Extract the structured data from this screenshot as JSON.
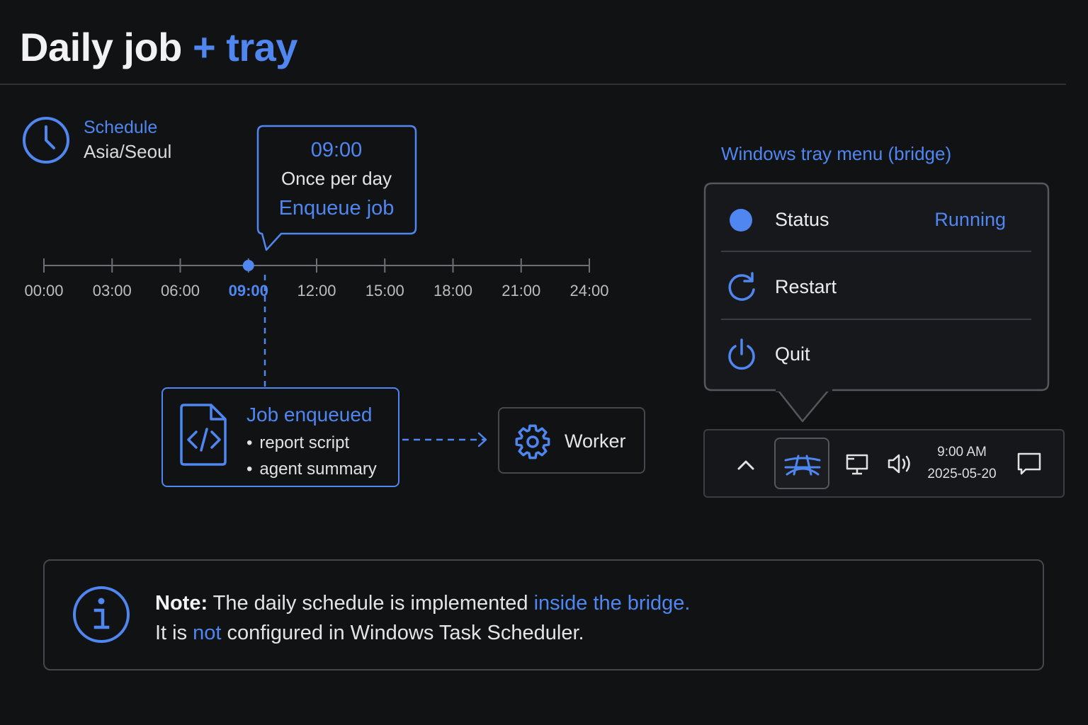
{
  "header": {
    "title_main": "Daily job",
    "title_accent": "+ tray"
  },
  "schedule": {
    "label": "Schedule",
    "timezone": "Asia/Seoul",
    "icon": "clock-icon"
  },
  "callout": {
    "time": "09:00",
    "frequency": "Once per day",
    "action": "Enqueue job"
  },
  "timeline": {
    "ticks": [
      "00:00",
      "03:00",
      "06:00",
      "09:00",
      "12:00",
      "15:00",
      "18:00",
      "21:00",
      "24:00"
    ],
    "active": "09:00"
  },
  "job": {
    "title": "Job enqueued",
    "items": [
      "report script",
      "agent summary"
    ],
    "icon": "code-file-icon"
  },
  "worker": {
    "label": "Worker",
    "icon": "gear-icon"
  },
  "tray_menu": {
    "title": "Windows tray menu (bridge)",
    "status_label": "Status",
    "status_value": "Running",
    "restart_label": "Restart",
    "quit_label": "Quit"
  },
  "taskbar": {
    "time": "9:00 AM",
    "date": "2025-05-20"
  },
  "note": {
    "lead": "Note:",
    "line1_text": " The daily schedule is implemented ",
    "line1_highlight": "inside the bridge.",
    "line2_pre": "It is ",
    "line2_highlight": "not",
    "line2_post": " configured in Windows Task Scheduler."
  },
  "colors": {
    "background": "#111214",
    "accent": "#4f86f0",
    "border": "#45474c",
    "text": "#e8e8ea"
  }
}
